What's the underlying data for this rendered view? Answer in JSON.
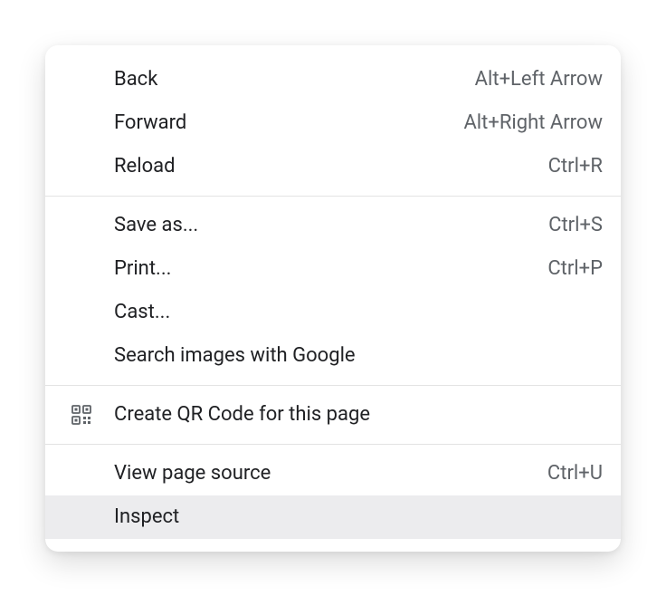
{
  "menu": {
    "groups": [
      [
        {
          "key": "back",
          "label": "Back",
          "shortcut": "Alt+Left Arrow",
          "icon": null
        },
        {
          "key": "forward",
          "label": "Forward",
          "shortcut": "Alt+Right Arrow",
          "icon": null
        },
        {
          "key": "reload",
          "label": "Reload",
          "shortcut": "Ctrl+R",
          "icon": null
        }
      ],
      [
        {
          "key": "save-as",
          "label": "Save as...",
          "shortcut": "Ctrl+S",
          "icon": null
        },
        {
          "key": "print",
          "label": "Print...",
          "shortcut": "Ctrl+P",
          "icon": null
        },
        {
          "key": "cast",
          "label": "Cast...",
          "shortcut": "",
          "icon": null
        },
        {
          "key": "search-images",
          "label": "Search images with Google",
          "shortcut": "",
          "icon": null
        }
      ],
      [
        {
          "key": "create-qr-code",
          "label": "Create QR Code for this page",
          "shortcut": "",
          "icon": "qr-code-icon"
        }
      ],
      [
        {
          "key": "view-page-source",
          "label": "View page source",
          "shortcut": "Ctrl+U",
          "icon": null
        },
        {
          "key": "inspect",
          "label": "Inspect",
          "shortcut": "",
          "icon": null,
          "hovered": true
        }
      ]
    ]
  }
}
